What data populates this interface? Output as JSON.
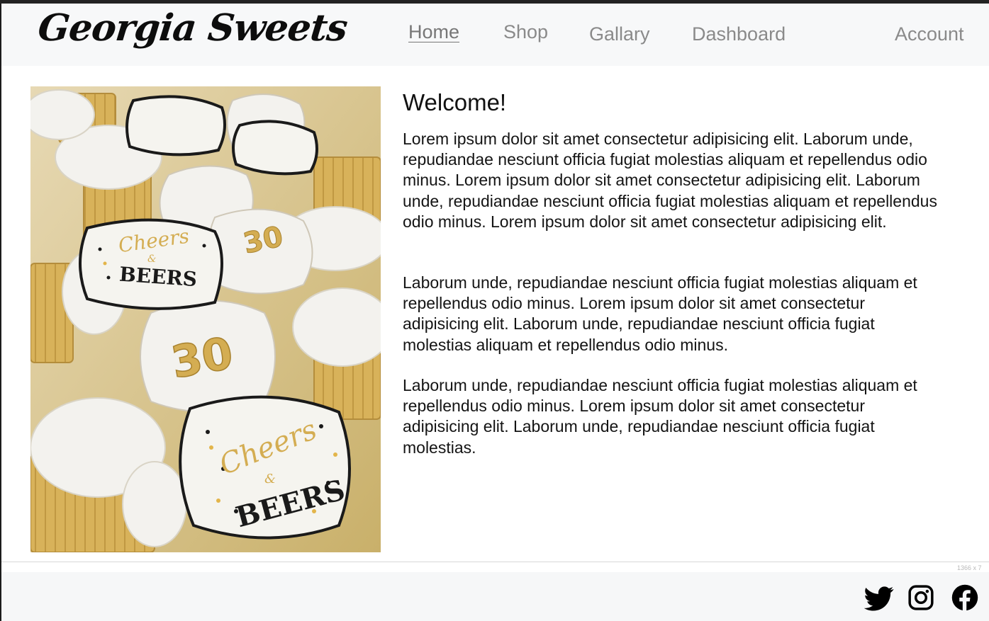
{
  "brand": {
    "name": "Georgia Sweets"
  },
  "nav": {
    "home": "Home",
    "shop": "Shop",
    "gallary": "Gallary",
    "dashboard": "Dashboard",
    "account": "Account",
    "active": "Home"
  },
  "hero": {
    "icon": "cheers-and-beers-cookies-photo",
    "cookie_text_1": "Cheers",
    "cookie_text_2": "&",
    "cookie_text_3": "BEERS",
    "cookie_number": "30"
  },
  "main": {
    "title": "Welcome!",
    "paragraphs": [
      "Lorem ipsum dolor sit amet consectetur adipisicing elit. Laborum unde, repudiandae nesciunt officia fugiat molestias aliquam et repellendus odio minus. Lorem ipsum dolor sit amet consectetur adipisicing elit. Laborum unde, repudiandae nesciunt officia fugiat molestias aliquam et repellendus odio minus. Lorem ipsum dolor sit amet consectetur adipisicing elit.",
      "Laborum unde, repudiandae nesciunt officia fugiat molestias aliquam et repellendus odio minus. Lorem ipsum dolor sit amet consectetur adipisicing elit. Laborum unde, repudiandae nesciunt officia fugiat molestias aliquam et repellendus odio minus.",
      "Laborum unde, repudiandae nesciunt officia fugiat molestias aliquam et repellendus odio minus. Lorem ipsum dolor sit amet consectetur adipisicing elit. Laborum unde, repudiandae nesciunt officia fugiat molestias."
    ]
  },
  "footer": {
    "resolution_label": "1366 x 7",
    "social": [
      "twitter-icon",
      "instagram-icon",
      "facebook-icon"
    ]
  },
  "colors": {
    "navbar_bg": "#f7f8f9",
    "nav_link": "#8a8a8a",
    "text": "#141414",
    "cookie_gold": "#d4ad52",
    "cookie_icing": "#f3f2ee"
  }
}
